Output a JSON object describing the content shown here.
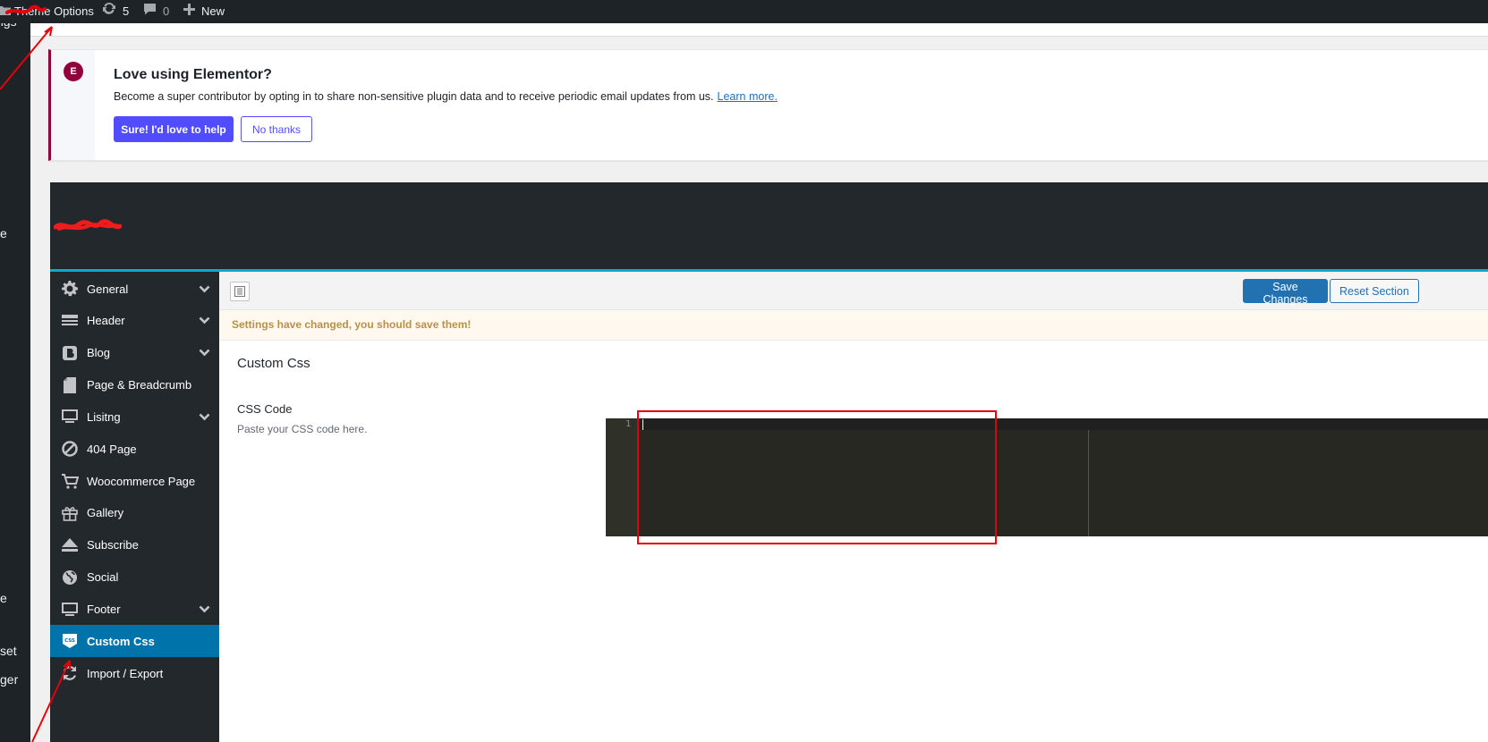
{
  "admin_bar": {
    "theme_options_label": "Theme Options",
    "updates_count": "5",
    "comments_count": "0",
    "new_label": "New"
  },
  "wp_menu_fragments": [
    "ngs",
    "e",
    "e",
    "set",
    "ger"
  ],
  "notice": {
    "logo_text": "E",
    "title": "Love using Elementor?",
    "description": "Become a super contributor by opting in to share non-sensitive plugin data and to receive periodic email updates from us.",
    "learn_more": "Learn more.",
    "accept_label": "Sure! I'd love to help",
    "decline_label": "No thanks"
  },
  "sidebar": {
    "items": [
      {
        "label": "General",
        "icon": "gear-icon",
        "chevron": true
      },
      {
        "label": "Header",
        "icon": "header-icon",
        "chevron": true
      },
      {
        "label": "Blog",
        "icon": "blog-icon",
        "chevron": true
      },
      {
        "label": "Page & Breadcrumb",
        "icon": "page-icon",
        "chevron": false
      },
      {
        "label": "Lisitng",
        "icon": "monitor-icon",
        "chevron": true
      },
      {
        "label": "404 Page",
        "icon": "ban-icon",
        "chevron": false
      },
      {
        "label": "Woocommerce Page",
        "icon": "cart-icon",
        "chevron": false
      },
      {
        "label": "Gallery",
        "icon": "gift-icon",
        "chevron": false
      },
      {
        "label": "Subscribe",
        "icon": "eject-icon",
        "chevron": false
      },
      {
        "label": "Social",
        "icon": "globe-icon",
        "chevron": false
      },
      {
        "label": "Footer",
        "icon": "monitor-icon",
        "chevron": true
      },
      {
        "label": "Custom Css",
        "icon": "css-icon",
        "chevron": false,
        "active": true
      },
      {
        "label": "Import / Export",
        "icon": "refresh-icon",
        "chevron": false
      }
    ]
  },
  "toolbar": {
    "save_label": "Save Changes",
    "reset_label": "Reset Section"
  },
  "warning": "Settings have changed, you should save them!",
  "section": {
    "title": "Custom Css",
    "field_title": "CSS Code",
    "field_desc": "Paste your CSS code here."
  },
  "editor": {
    "line_number": "1",
    "value": ""
  },
  "colors": {
    "elementor_accent": "#92003b",
    "primary_button": "#524cff",
    "active_menu": "#0073aa",
    "annotation_red": "#e3000b"
  }
}
